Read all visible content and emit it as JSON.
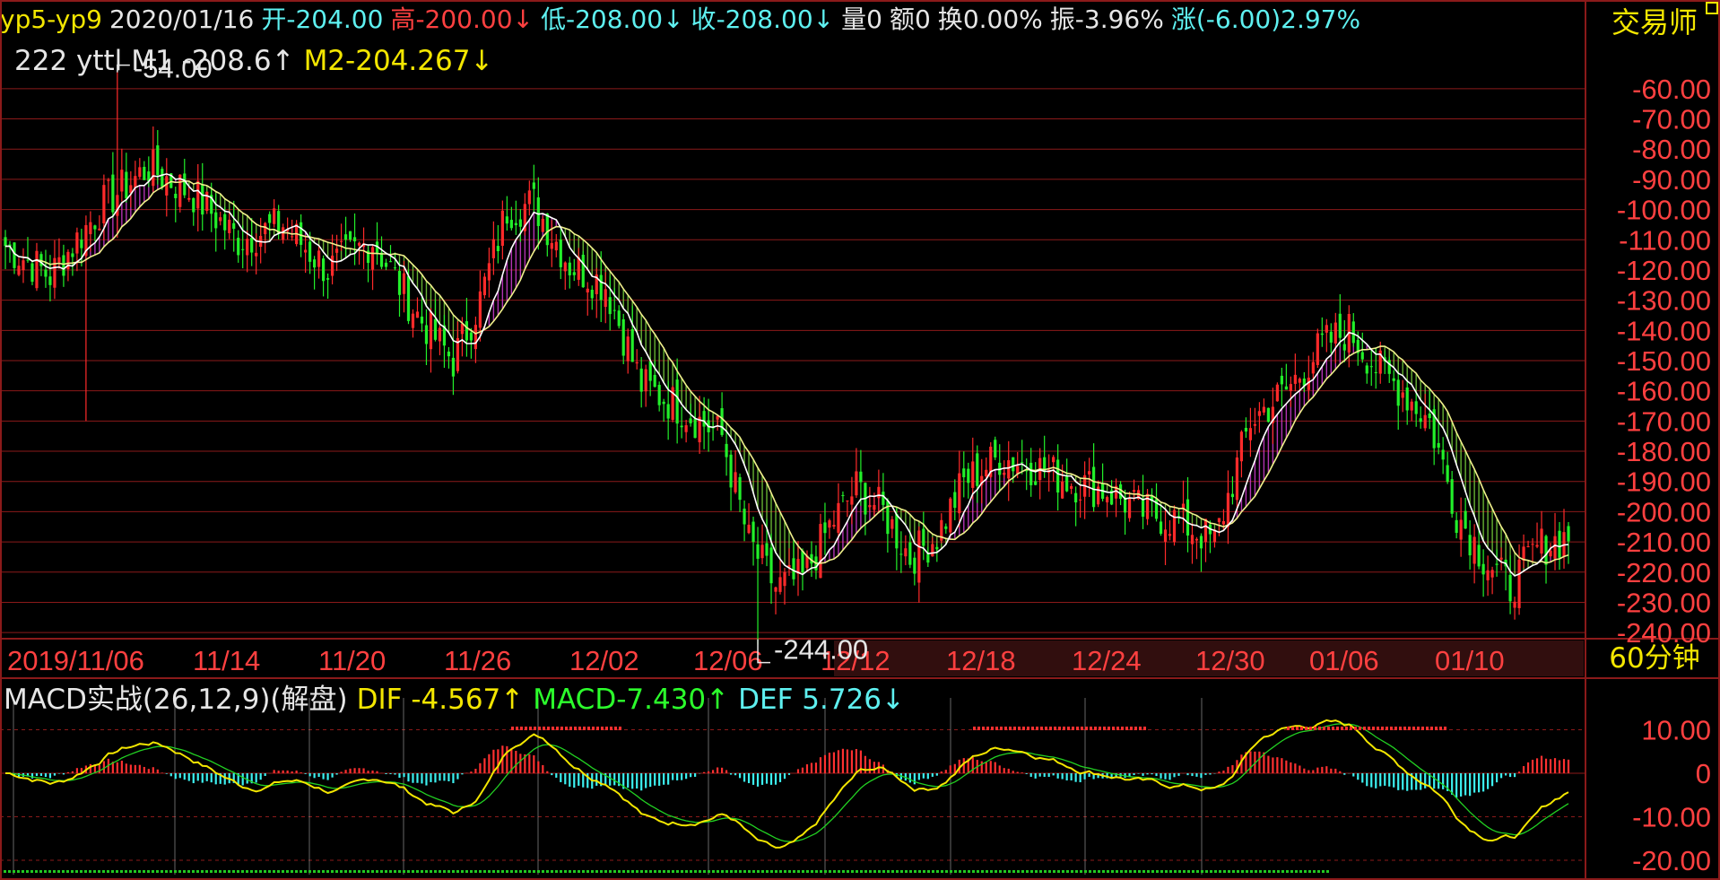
{
  "header": {
    "symbol": "yp5-yp9",
    "date": "2020/01/16",
    "open_label": "开",
    "open": "-204.00",
    "high_label": "高",
    "high": "-200.00↓",
    "low_label": "低",
    "low": "-208.00↓",
    "close_label": "收",
    "close": "-208.00↓",
    "volume_label": "量",
    "volume": "0",
    "amount_label": "额",
    "amount": "0",
    "turnover_label": "换",
    "turnover": "0.00%",
    "amplitude_label": "振",
    "amplitude": "-3.96%",
    "change_label": "涨",
    "change": "(-6.00)2.97%",
    "brand": "交易师"
  },
  "ma_legend": {
    "name": "222 yttl",
    "m1_label": "M1",
    "m1_value": "-208.6↑",
    "m2_label": "M2",
    "m2_value": "-204.267↓"
  },
  "macd_legend": {
    "name": "MACD实战(26,12,9)(解盘)",
    "dif_label": "DIF",
    "dif_value": "-4.567↑",
    "macd_label": "MACD",
    "macd_value": "-7.430↑",
    "def_label": "DEF",
    "def_value": "5.726↓"
  },
  "timeframe": "60分钟",
  "colors": {
    "background": "#000000",
    "grid": "#8b1a1a",
    "up": "#ff2a2a",
    "down": "#22f02a",
    "m1_line": "#ffffff",
    "m2_line": "#f0f08c",
    "cloud_up": "#d23cd2",
    "cloud_down": "#78d23c",
    "dif": "#f3e600",
    "dea": "#22d022",
    "hist_pos": "#ff3030",
    "hist_neg": "#3cf0f0",
    "axis_text": "#ff4040"
  },
  "chart_data": [
    {
      "type": "candlestick",
      "title": "yp5-yp9 60分钟",
      "y_ticks": [
        -60,
        -70,
        -80,
        -90,
        -100,
        -110,
        -120,
        -130,
        -140,
        -150,
        -160,
        -170,
        -180,
        -190,
        -200,
        -210,
        -220,
        -230,
        -240
      ],
      "y_tick_labels": [
        "-60.00",
        "-70.00",
        "-80.00",
        "-90.00",
        "-100.00",
        "-110.00",
        "-120.00",
        "-130.00",
        "-140.00",
        "-150.00",
        "-160.00",
        "-170.00",
        "-180.00",
        "-190.00",
        "-200.00",
        "-210.00",
        "-220.00",
        "-230.00",
        "-240.00"
      ],
      "ylim": [
        -245,
        -55
      ],
      "x_tick_labels": [
        "2019/11/06",
        "11/14",
        "11/20",
        "11/26",
        "12/02",
        "12/06",
        "12/12",
        "12/18",
        "12/24",
        "12/30",
        "01/06",
        "01/10"
      ],
      "annotations": [
        {
          "text": "-54.00",
          "value": -54.0,
          "kind": "period_high"
        },
        {
          "text": "-244.00",
          "value": -244.0,
          "kind": "period_low"
        }
      ],
      "close_anchors": [
        {
          "i": 0,
          "close": -112
        },
        {
          "i": 10,
          "close": -122
        },
        {
          "i": 22,
          "close": -98
        },
        {
          "i": 32,
          "close": -86
        },
        {
          "i": 42,
          "close": -95
        },
        {
          "i": 52,
          "close": -110
        },
        {
          "i": 62,
          "close": -105
        },
        {
          "i": 72,
          "close": -120
        },
        {
          "i": 82,
          "close": -110
        },
        {
          "i": 92,
          "close": -135
        },
        {
          "i": 100,
          "close": -150
        },
        {
          "i": 106,
          "close": -130
        },
        {
          "i": 112,
          "close": -100
        },
        {
          "i": 118,
          "close": -98
        },
        {
          "i": 126,
          "close": -118
        },
        {
          "i": 134,
          "close": -125
        },
        {
          "i": 142,
          "close": -158
        },
        {
          "i": 150,
          "close": -165
        },
        {
          "i": 160,
          "close": -175
        },
        {
          "i": 166,
          "close": -210
        },
        {
          "i": 172,
          "close": -225
        },
        {
          "i": 178,
          "close": -222
        },
        {
          "i": 184,
          "close": -205
        },
        {
          "i": 190,
          "close": -192
        },
        {
          "i": 196,
          "close": -200
        },
        {
          "i": 202,
          "close": -215
        },
        {
          "i": 208,
          "close": -208
        },
        {
          "i": 214,
          "close": -190
        },
        {
          "i": 222,
          "close": -182
        },
        {
          "i": 230,
          "close": -185
        },
        {
          "i": 238,
          "close": -190
        },
        {
          "i": 246,
          "close": -193
        },
        {
          "i": 254,
          "close": -200
        },
        {
          "i": 262,
          "close": -203
        },
        {
          "i": 270,
          "close": -210
        },
        {
          "i": 278,
          "close": -170
        },
        {
          "i": 286,
          "close": -160
        },
        {
          "i": 294,
          "close": -145
        },
        {
          "i": 300,
          "close": -140
        },
        {
          "i": 306,
          "close": -152
        },
        {
          "i": 312,
          "close": -160
        },
        {
          "i": 318,
          "close": -170
        },
        {
          "i": 324,
          "close": -200
        },
        {
          "i": 330,
          "close": -215
        },
        {
          "i": 336,
          "close": -225
        },
        {
          "i": 342,
          "close": -212
        },
        {
          "i": 349,
          "close": -208
        }
      ],
      "series_count": 350
    },
    {
      "type": "macd",
      "title": "MACD实战(26,12,9)(解盘)",
      "y_ticks": [
        10,
        0,
        -10,
        -20
      ],
      "y_tick_labels": [
        "10.00",
        "0",
        "-10.00",
        "-20.00"
      ],
      "ylim": [
        -22,
        13
      ],
      "series": [
        {
          "name": "DIF",
          "last": -4.567
        },
        {
          "name": "MACD",
          "last": -7.43
        },
        {
          "name": "DEF",
          "last": 5.726
        }
      ]
    }
  ]
}
